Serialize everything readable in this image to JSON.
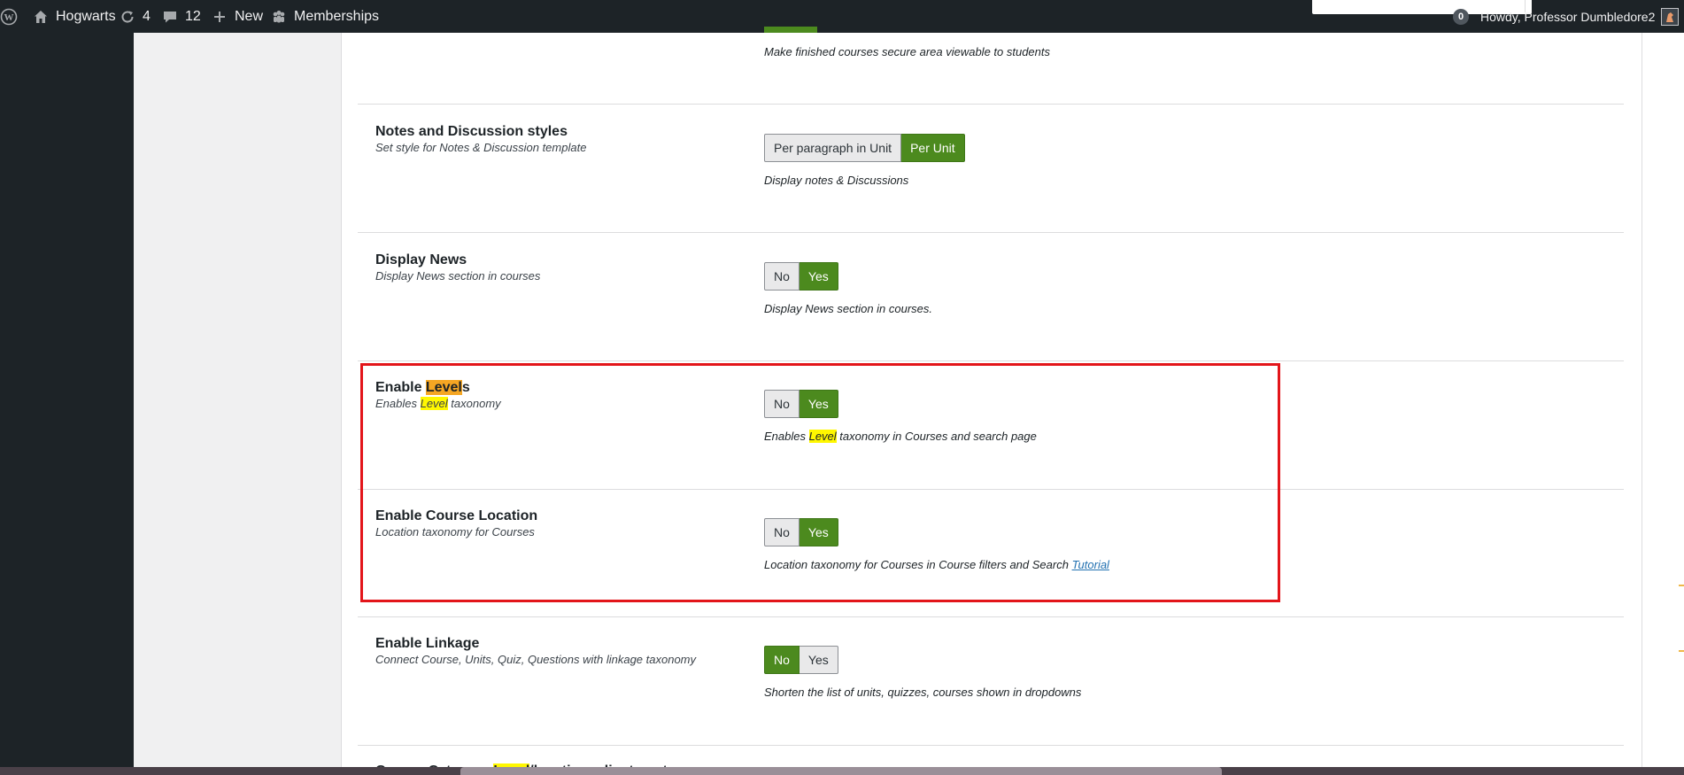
{
  "admin_bar": {
    "site_name": "Hogwarts",
    "updates_count": "4",
    "comments_count": "12",
    "new_label": "New",
    "memberships_label": "Memberships",
    "notifications_count": "0",
    "greeting": "Howdy, Professor Dumbledore2"
  },
  "settings": {
    "secure_area": {
      "description": "Make finished courses secure area viewable to students"
    },
    "notes_discussion": {
      "title": "Notes and Discussion styles",
      "subtitle": "Set style for Notes & Discussion template",
      "option_a": "Per paragraph in Unit",
      "option_b": "Per Unit",
      "selected": "Per Unit",
      "description": "Display notes & Discussions"
    },
    "display_news": {
      "title": "Display News",
      "subtitle": "Display News section in courses",
      "option_no": "No",
      "option_yes": "Yes",
      "selected": "Yes",
      "description": "Display News section in courses."
    },
    "enable_levels": {
      "title_prefix": "Enable ",
      "title_highlight": "Level",
      "title_suffix": "s",
      "subtitle_prefix": "Enables ",
      "subtitle_highlight": "Level",
      "subtitle_suffix": " taxonomy",
      "option_no": "No",
      "option_yes": "Yes",
      "selected": "Yes",
      "description_prefix": "Enables ",
      "description_highlight": "Level",
      "description_suffix": " taxonomy in Courses and search page"
    },
    "course_location": {
      "title": "Enable Course Location",
      "subtitle": "Location taxonomy for Courses",
      "option_no": "No",
      "option_yes": "Yes",
      "selected": "Yes",
      "description": "Location taxonomy for Courses in Course filters and Search ",
      "link_text": "Tutorial"
    },
    "linkage": {
      "title": "Enable Linkage",
      "subtitle": "Connect Course, Units, Quiz, Questions with linkage taxonomy",
      "option_no": "No",
      "option_yes": "Yes",
      "selected": "No",
      "description": "Shorten the list of units, quizzes, courses shown in dropdowns"
    },
    "next_row_partial": {
      "title_prefix": "Course Category ",
      "title_highlight": "Level",
      "title_suffix": "/location adjustment"
    }
  },
  "colors": {
    "toggle_active": "#4c8a1e",
    "highlight_box": "#e3151a",
    "search_highlight_current": "#f5a623",
    "search_highlight": "#fff700",
    "admin_bar": "#1d2327"
  },
  "icons": [
    "wordpress-icon",
    "home-icon",
    "updates-icon",
    "comment-icon",
    "plus-icon",
    "memberships-icon"
  ]
}
